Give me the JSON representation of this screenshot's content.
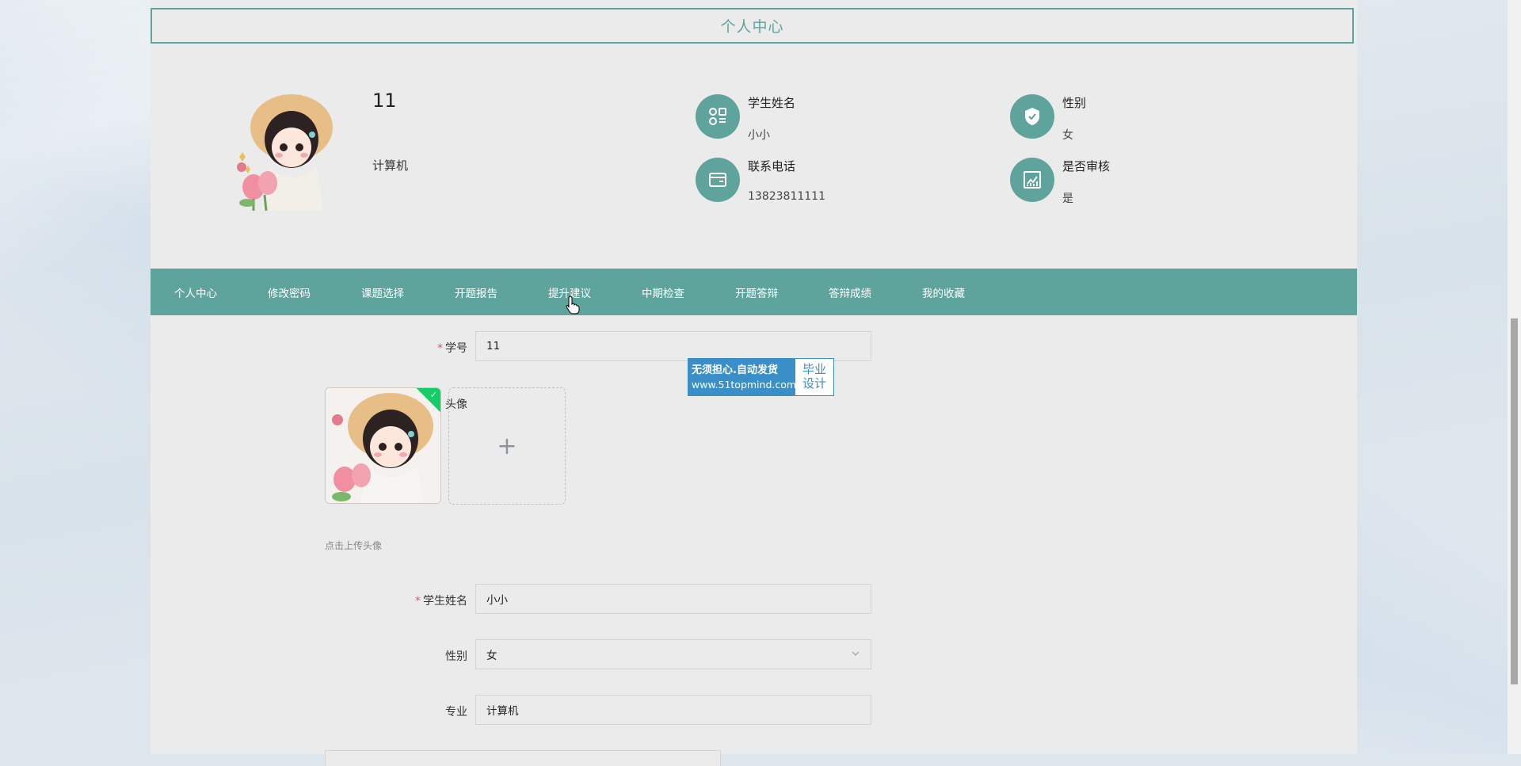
{
  "header": {
    "title": "个人中心"
  },
  "profile": {
    "username": "11",
    "major": "计算机",
    "info": [
      {
        "label": "学生姓名",
        "value": "小小",
        "icon": "apps-icon"
      },
      {
        "label": "性别",
        "value": "女",
        "icon": "shield-check-icon"
      },
      {
        "label": "联系电话",
        "value": "13823811111",
        "icon": "wallet-icon"
      },
      {
        "label": "是否审核",
        "value": "是",
        "icon": "chart-icon"
      }
    ]
  },
  "nav": {
    "items": [
      {
        "label": "个人中心"
      },
      {
        "label": "修改密码"
      },
      {
        "label": "课题选择"
      },
      {
        "label": "开题报告"
      },
      {
        "label": "提升建议"
      },
      {
        "label": "中期检查"
      },
      {
        "label": "开题答辩"
      },
      {
        "label": "答辩成绩"
      },
      {
        "label": "我的收藏"
      }
    ]
  },
  "form": {
    "student_id": {
      "label": "学号",
      "value": "11",
      "required": "*"
    },
    "avatar": {
      "label": "头像",
      "hint": "点击上传头像",
      "add": "+"
    },
    "student_name": {
      "label": "学生姓名",
      "value": "小小",
      "required": "*"
    },
    "gender": {
      "label": "性别",
      "value": "女"
    },
    "major": {
      "label": "专业",
      "value": "计算机"
    }
  },
  "watermark": {
    "line1": "无须担心.自动发货",
    "line2": "www.51topmind.com",
    "right1": "毕业",
    "right2": "设计"
  },
  "colors": {
    "accent": "#5fa39d",
    "required": "#e25b5b",
    "watermark": "#3b8fc8"
  }
}
